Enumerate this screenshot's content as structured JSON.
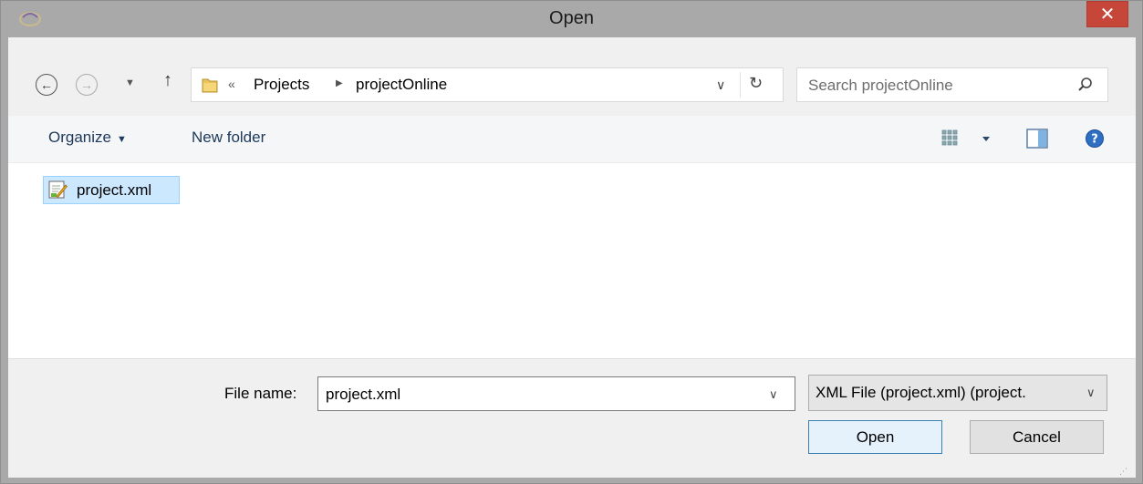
{
  "window": {
    "title": "Open"
  },
  "icons": {
    "app": "app-icon",
    "close": "close-icon",
    "back": "back-arrow-icon",
    "forward": "forward-arrow-icon",
    "up": "up-arrow-icon",
    "folder": "folder-icon",
    "refresh": "refresh-icon",
    "search": "search-icon",
    "view": "view-options-icon",
    "preview_pane": "preview-pane-icon",
    "help": "help-icon",
    "file": "xml-file-icon"
  },
  "nav": {
    "close_glyph": "✕",
    "back_glyph": "←",
    "forward_glyph": "→",
    "recent_glyph": "▼",
    "up_glyph": "↑"
  },
  "address": {
    "more_glyph": "«",
    "crumbs": [
      "Projects",
      "projectOnline"
    ],
    "sep_glyph": "▶",
    "dropdown_glyph": "∨",
    "refresh_glyph": "↻"
  },
  "search": {
    "placeholder": "Search projectOnline"
  },
  "toolbar": {
    "organize_label": "Organize",
    "organize_caret": "▼",
    "new_folder_label": "New folder"
  },
  "files": [
    {
      "name": "project.xml"
    }
  ],
  "bottom": {
    "file_name_label": "File name:",
    "file_name_value": "project.xml",
    "file_name_caret": "∨",
    "file_type_value": "XML File (project.xml)  (project.",
    "file_type_caret": "∨",
    "open_label": "Open",
    "cancel_label": "Cancel",
    "grip_glyph": "⋰"
  },
  "colors": {
    "titlebar": "#a9a9a9",
    "close_button": "#c7463a",
    "selection": "#cce8ff",
    "toolbar_text": "#1e395b"
  }
}
